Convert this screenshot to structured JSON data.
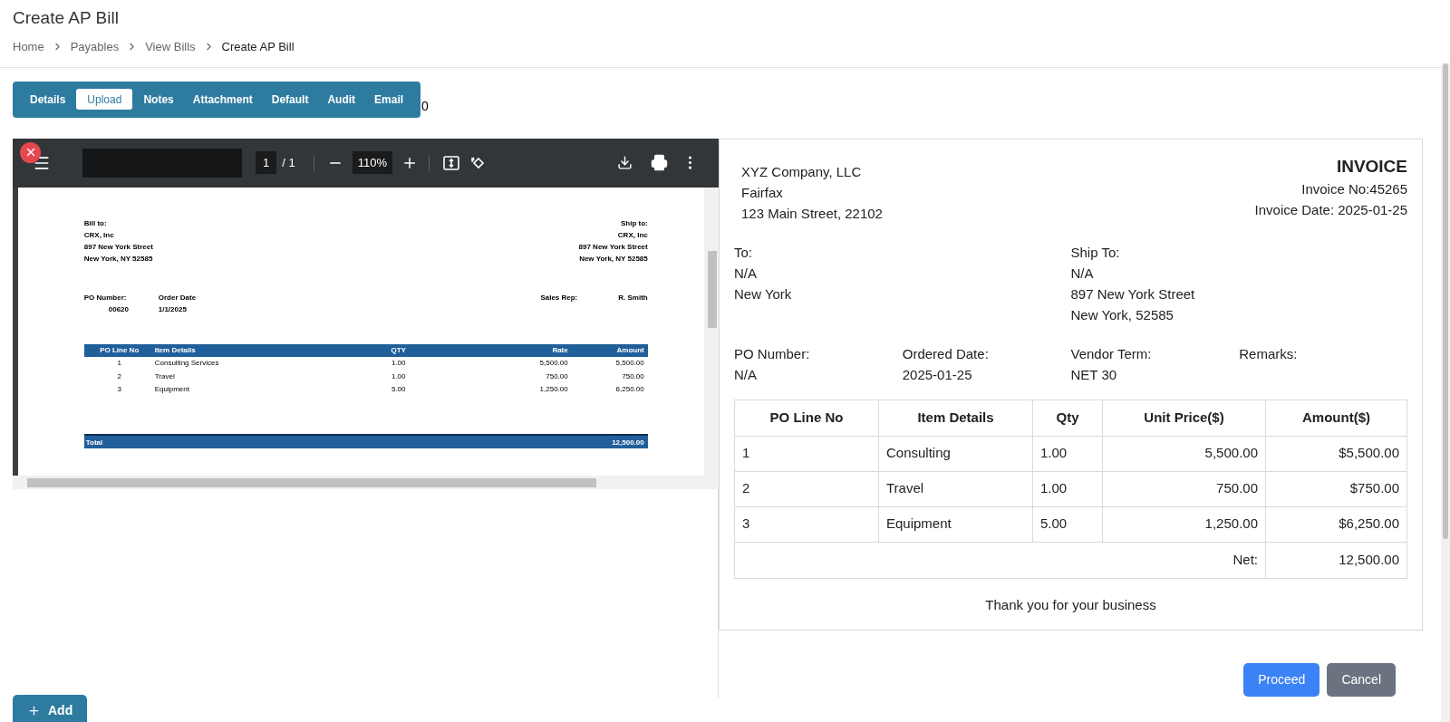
{
  "page": {
    "title": "Create AP Bill",
    "breadcrumb": [
      "Home",
      "Payables",
      "View Bills",
      "Create AP Bill"
    ]
  },
  "tabs": [
    {
      "label": "Details",
      "selected": false
    },
    {
      "label": "Upload",
      "selected": true
    },
    {
      "label": "Notes",
      "selected": false
    },
    {
      "label": "Attachment",
      "selected": false
    },
    {
      "label": "Default",
      "selected": false
    },
    {
      "label": "Audit",
      "selected": false
    },
    {
      "label": "Email",
      "selected": false
    }
  ],
  "tab_counter": "0",
  "pdf_viewer": {
    "page_input": "1",
    "page_total": "/ 1",
    "zoom": "110%",
    "document": {
      "bill_to": {
        "label": "Bill to:",
        "lines": [
          "CRX, Inc",
          "897 New York Street",
          "New York, NY 52585"
        ]
      },
      "ship_to": {
        "label": "Ship to:",
        "lines": [
          "CRX, Inc",
          "897 New York Street",
          "New York, NY 52585"
        ]
      },
      "po_number": {
        "label": "PO Number:",
        "value": "00620"
      },
      "order_date": {
        "label": "Order Date",
        "value": "1/1/2025"
      },
      "sales_rep": {
        "label": "Sales Rep:",
        "value": "R. Smith"
      },
      "table": {
        "columns": [
          "PO Line No",
          "Item Details",
          "QTY",
          "Rate",
          "Amount"
        ],
        "rows": [
          [
            "1",
            "Consulting Services",
            "1.00",
            "5,500.00",
            "5,500.00"
          ],
          [
            "2",
            "Travel",
            "1.00",
            "750.00",
            "750.00"
          ],
          [
            "3",
            "Equipment",
            "5.00",
            "1,250.00",
            "6,250.00"
          ]
        ]
      },
      "total": {
        "label": "Total",
        "value": "12,500.00"
      }
    }
  },
  "invoice": {
    "company_lines": [
      "XYZ Company, LLC",
      "Fairfax",
      "123 Main Street, 22102"
    ],
    "title": "INVOICE",
    "invoice_no": "Invoice No:45265",
    "invoice_date": "Invoice Date: 2025-01-25",
    "to": {
      "label": "To:",
      "lines": [
        "N/A",
        "New York"
      ]
    },
    "ship_to": {
      "label": "Ship To:",
      "lines": [
        "N/A",
        "897 New York Street",
        "New York, 52585"
      ]
    },
    "fields": [
      {
        "label": "PO Number:",
        "value": "N/A"
      },
      {
        "label": "Ordered Date:",
        "value": "2025-01-25"
      },
      {
        "label": "Vendor Term:",
        "value": "NET 30"
      },
      {
        "label": "Remarks:"
      }
    ],
    "table": {
      "columns": [
        "PO Line No",
        "Item Details",
        "Qty",
        "Unit Price($)",
        "Amount($)"
      ],
      "rows": [
        [
          "1",
          "Consulting",
          "1.00",
          "5,500.00",
          "$5,500.00"
        ],
        [
          "2",
          "Travel",
          "1.00",
          "750.00",
          "$750.00"
        ],
        [
          "3",
          "Equipment",
          "5.00",
          "1,250.00",
          "$6,250.00"
        ]
      ],
      "net_label": "Net:",
      "net_value": "12,500.00"
    },
    "footer": "Thank you for your business"
  },
  "buttons": [
    {
      "label": "Proceed",
      "kind": "primary"
    },
    {
      "label": "Cancel",
      "kind": "secondary"
    }
  ],
  "add_button": "Add"
}
